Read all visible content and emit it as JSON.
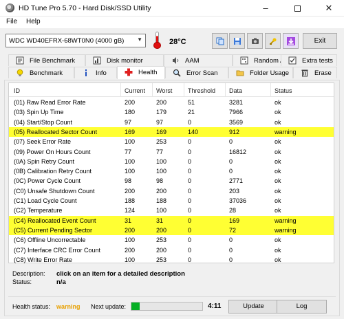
{
  "window": {
    "title": "HD Tune Pro 5.70 - Hard Disk/SSD Utility",
    "minimize": "–",
    "close": "✕"
  },
  "menu": {
    "file": "File",
    "help": "Help"
  },
  "toolbar": {
    "drive": "WDC WD40EFRX-68WT0N0 (4000 gB)",
    "temperature": "28°C",
    "exit_label": "Exit",
    "icons": [
      "copy-icon",
      "save-icon",
      "camera-icon",
      "tools-icon",
      "download-icon"
    ]
  },
  "tabs": {
    "row1": [
      "File Benchmark",
      "Disk monitor",
      "AAM",
      "Random Access",
      "Extra tests"
    ],
    "row2": [
      "Benchmark",
      "Info",
      "Health",
      "Error Scan",
      "Folder Usage",
      "Erase"
    ],
    "active": "Health"
  },
  "table": {
    "headers": [
      "ID",
      "Current",
      "Worst",
      "Threshold",
      "Data",
      "Status"
    ],
    "rows": [
      {
        "id": "(01) Raw Read Error Rate",
        "current": "200",
        "worst": "200",
        "threshold": "51",
        "data": "3281",
        "status": "ok",
        "warn": false
      },
      {
        "id": "(03) Spin Up Time",
        "current": "180",
        "worst": "179",
        "threshold": "21",
        "data": "7966",
        "status": "ok",
        "warn": false
      },
      {
        "id": "(04) Start/Stop Count",
        "current": "97",
        "worst": "97",
        "threshold": "0",
        "data": "3569",
        "status": "ok",
        "warn": false
      },
      {
        "id": "(05) Reallocated Sector Count",
        "current": "169",
        "worst": "169",
        "threshold": "140",
        "data": "912",
        "status": "warning",
        "warn": true
      },
      {
        "id": "(07) Seek Error Rate",
        "current": "100",
        "worst": "253",
        "threshold": "0",
        "data": "0",
        "status": "ok",
        "warn": false
      },
      {
        "id": "(09) Power On Hours Count",
        "current": "77",
        "worst": "77",
        "threshold": "0",
        "data": "16812",
        "status": "ok",
        "warn": false
      },
      {
        "id": "(0A) Spin Retry Count",
        "current": "100",
        "worst": "100",
        "threshold": "0",
        "data": "0",
        "status": "ok",
        "warn": false
      },
      {
        "id": "(0B) Calibration Retry Count",
        "current": "100",
        "worst": "100",
        "threshold": "0",
        "data": "0",
        "status": "ok",
        "warn": false
      },
      {
        "id": "(0C) Power Cycle Count",
        "current": "98",
        "worst": "98",
        "threshold": "0",
        "data": "2771",
        "status": "ok",
        "warn": false
      },
      {
        "id": "(C0) Unsafe Shutdown Count",
        "current": "200",
        "worst": "200",
        "threshold": "0",
        "data": "203",
        "status": "ok",
        "warn": false
      },
      {
        "id": "(C1) Load Cycle Count",
        "current": "188",
        "worst": "188",
        "threshold": "0",
        "data": "37036",
        "status": "ok",
        "warn": false
      },
      {
        "id": "(C2) Temperature",
        "current": "124",
        "worst": "100",
        "threshold": "0",
        "data": "28",
        "status": "ok",
        "warn": false
      },
      {
        "id": "(C4) Reallocated Event Count",
        "current": "31",
        "worst": "31",
        "threshold": "0",
        "data": "169",
        "status": "warning",
        "warn": true
      },
      {
        "id": "(C5) Current Pending Sector",
        "current": "200",
        "worst": "200",
        "threshold": "0",
        "data": "72",
        "status": "warning",
        "warn": true
      },
      {
        "id": "(C6) Offline Uncorrectable",
        "current": "100",
        "worst": "253",
        "threshold": "0",
        "data": "0",
        "status": "ok",
        "warn": false
      },
      {
        "id": "(C7) Interface CRC Error Count",
        "current": "200",
        "worst": "200",
        "threshold": "0",
        "data": "0",
        "status": "ok",
        "warn": false
      },
      {
        "id": "(C8) Write Error Rate",
        "current": "100",
        "worst": "253",
        "threshold": "0",
        "data": "0",
        "status": "ok",
        "warn": false
      }
    ]
  },
  "description": {
    "desc_label": "Description:",
    "desc_value": "click on an item for a detailed description",
    "status_label": "Status:",
    "status_value": "n/a"
  },
  "footer": {
    "health_label": "Health status:",
    "health_value": "warning",
    "next_update_label": "Next update:",
    "progress_fraction": 0.12,
    "countdown": "4:11",
    "update_label": "Update",
    "log_label": "Log"
  },
  "colors": {
    "warning_row": "#ffff33",
    "warning_text": "#e8a000",
    "progress": "#06b025"
  }
}
